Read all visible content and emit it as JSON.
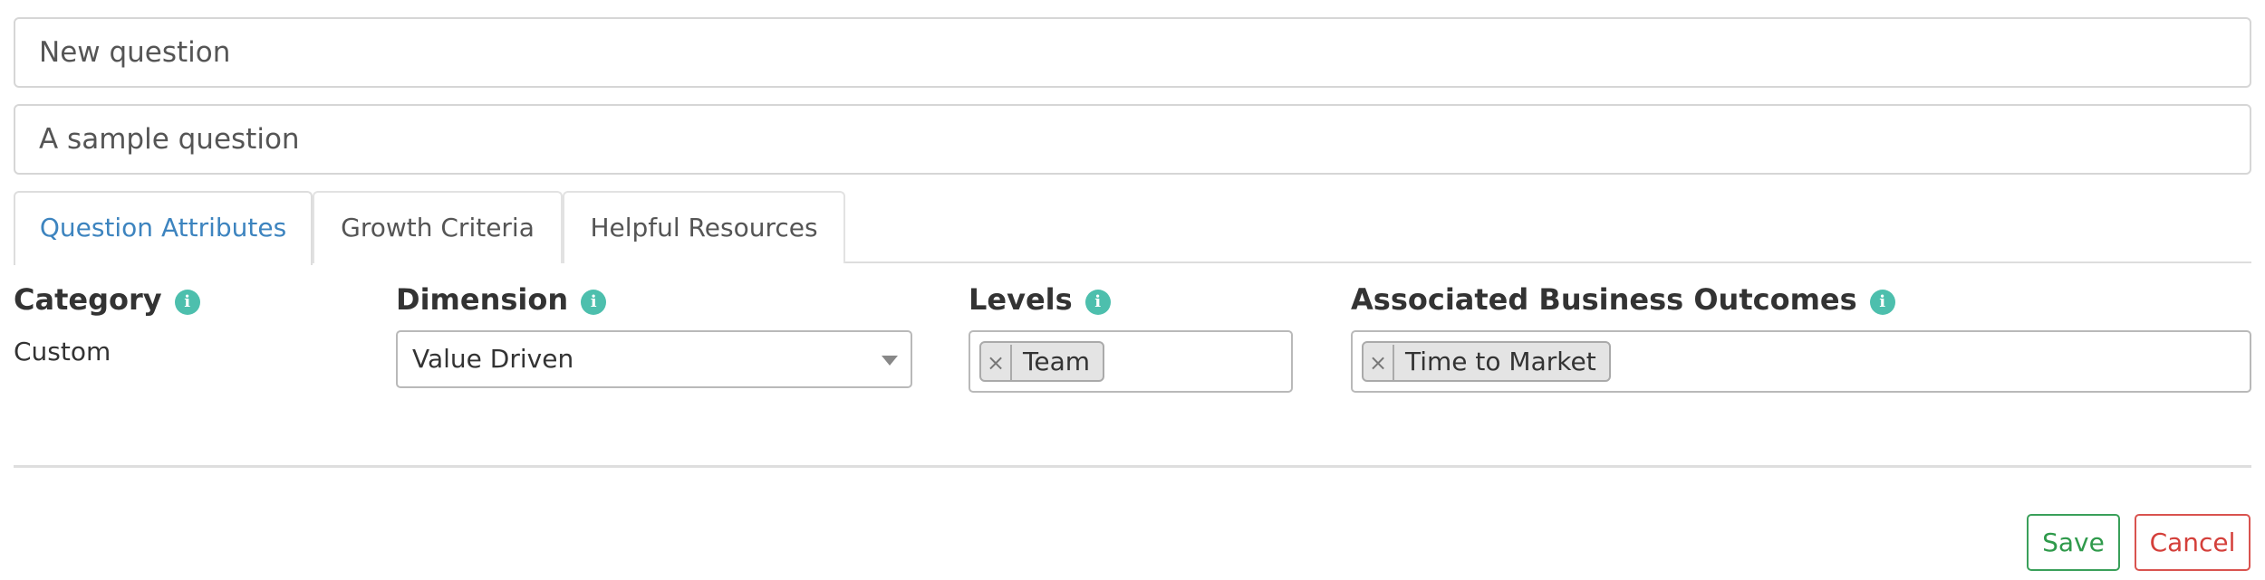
{
  "form": {
    "title_value": "New question",
    "description_value": "A sample question"
  },
  "tabs": [
    {
      "label": "Question Attributes",
      "active": true
    },
    {
      "label": "Growth Criteria",
      "active": false
    },
    {
      "label": "Helpful Resources",
      "active": false
    }
  ],
  "attributes": {
    "category": {
      "label": "Category",
      "value": "Custom",
      "info_icon": "i"
    },
    "dimension": {
      "label": "Dimension",
      "selected": "Value Driven",
      "info_icon": "i"
    },
    "levels": {
      "label": "Levels",
      "tags": [
        "Team"
      ],
      "info_icon": "i"
    },
    "business_outcomes": {
      "label": "Associated Business Outcomes",
      "tags": [
        "Time to Market"
      ],
      "info_icon": "i"
    },
    "tag_remove_glyph": "×"
  },
  "actions": {
    "save_label": "Save",
    "cancel_label": "Cancel"
  },
  "colors": {
    "accent_tab": "#3d84bf",
    "info_icon": "#4dbfad",
    "save": "#2f9a4b",
    "cancel": "#d43f3a"
  }
}
